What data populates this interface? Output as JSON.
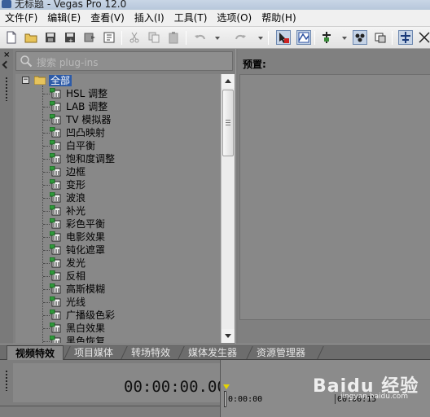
{
  "window": {
    "title": "无标题 - Vegas Pro 12.0"
  },
  "menu": [
    "文件(F)",
    "编辑(E)",
    "查看(V)",
    "插入(I)",
    "工具(T)",
    "选项(O)",
    "帮助(H)"
  ],
  "toolbar": {
    "icons": [
      "new-file-icon",
      "open-folder-icon",
      "save-icon",
      "save-as-icon",
      "render-icon",
      "properties-icon",
      "cut-icon",
      "copy-icon",
      "paste-icon",
      "undo-icon",
      "redo-icon",
      "normal-edit-tool-icon",
      "envelope-tool-icon",
      "snapping-icon",
      "auto-ripple-icon",
      "lock-envelopes-icon",
      "ignore-grouping-icon"
    ]
  },
  "search": {
    "placeholder": "搜索 plug-ins"
  },
  "tree": {
    "root": "全部",
    "items": [
      "HSL 调整",
      "LAB 调整",
      "TV 模拟器",
      "凹凸映射",
      "白平衡",
      "饱和度调整",
      "边框",
      "变形",
      "波浪",
      "补光",
      "彩色平衡",
      "电影效果",
      "钝化遮罩",
      "发光",
      "反相",
      "高斯模糊",
      "光线",
      "广播级色彩",
      "黑白效果",
      "黑色恢复"
    ]
  },
  "preview": {
    "label": "预置:"
  },
  "tabs": [
    "视频特效",
    "项目媒体",
    "转场特效",
    "媒体发生器",
    "资源管理器"
  ],
  "timeline": {
    "timecode": "00:00:00.00",
    "ruler_labels": [
      "0:00:00",
      "00:00:15"
    ]
  },
  "watermark": {
    "text": "Baidu 经验",
    "sub": "jingyan.baidu.com"
  },
  "colors": {
    "selection": "#2d5ba8",
    "panel": "#888888",
    "marker": "#e4d400"
  }
}
